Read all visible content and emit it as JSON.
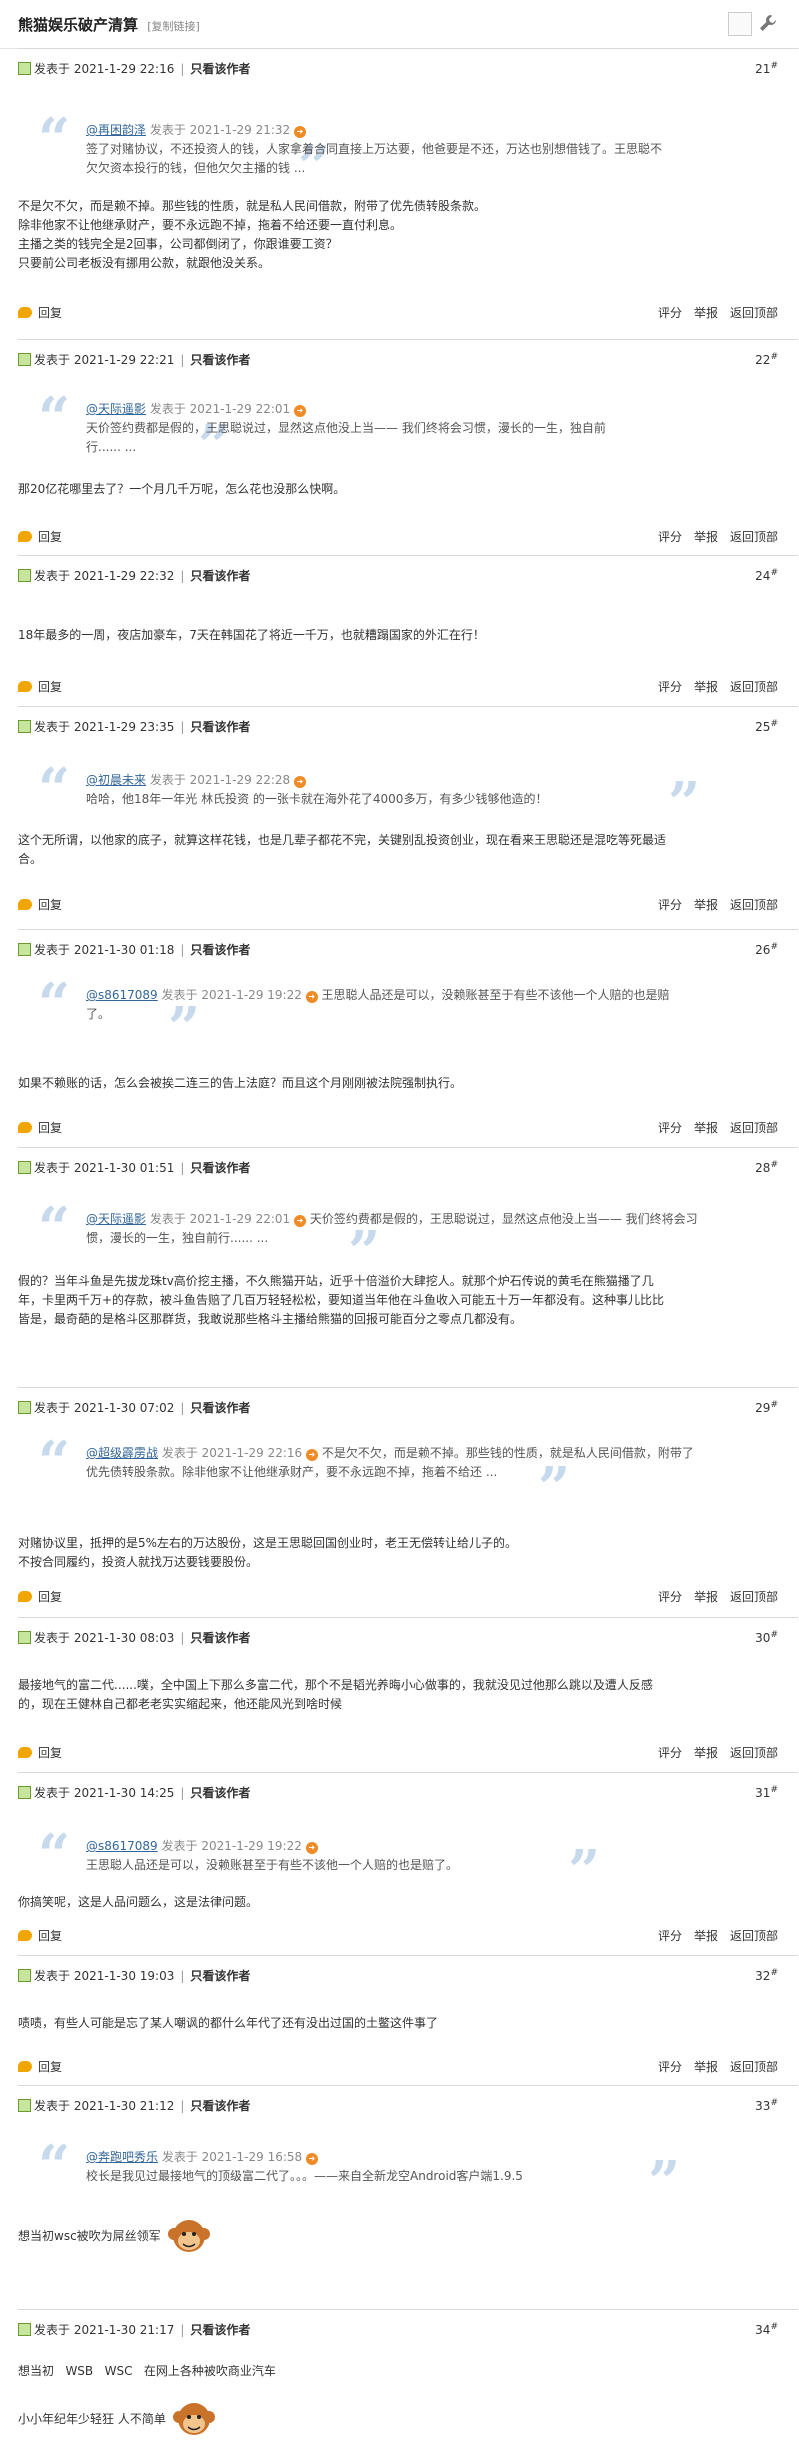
{
  "header": {
    "title": "熊猫娱乐破产清算",
    "copy_link": "[复制链接]"
  },
  "common": {
    "posted": "发表于",
    "only_author": "只看该作者",
    "reply": "回复",
    "rate": "评分",
    "report": "举报",
    "top": "返回顶部",
    "floor_sign": "#"
  },
  "posts": [
    {
      "date": "2021-1-29 22:16",
      "floor": "21",
      "quote": {
        "user": "@再困韵泽",
        "time": "发表于 2021-1-29 21:32",
        "text1": "签了对赌协议，不还投资人的钱，人家拿着合同直接上万达要，他爸要是不还，万达也别想借钱了。王思聪不",
        "text2": "欠欠资本投行的钱，但他欠欠主播的钱 ..."
      },
      "body": [
        "不是欠不欠，而是赖不掉。那些钱的性质，就是私人民间借款，附带了优先债转股条款。",
        "除非他家不让他继承财产，要不永远跑不掉，拖着不给还要一直付利息。",
        "主播之类的钱完全是2回事，公司都倒闭了，你跟谁要工资？",
        "只要前公司老板没有挪用公款，就跟他没关系。"
      ]
    },
    {
      "date": "2021-1-29 22:21",
      "floor": "22",
      "quote": {
        "user": "@天际遥影",
        "time": "发表于 2021-1-29 22:01",
        "text1": "天价签约费都是假的，王思聪说过，显然这点他没上当—— 我们终将会习惯，漫长的一生，独自前",
        "text2": "行...... ..."
      },
      "body": [
        "那20亿花哪里去了？一个月几千万呢，怎么花也没那么快啊。"
      ]
    },
    {
      "date": "2021-1-29 22:32",
      "floor": "24",
      "body": [
        "18年最多的一周，夜店加豪车，7天在韩国花了将近一千万，也就糟蹋国家的外汇在行！"
      ]
    },
    {
      "date": "2021-1-29 23:35",
      "floor": "25",
      "quote": {
        "user": "@初晨未来",
        "time": "发表于 2021-1-29 22:28",
        "text1": "哈哈，他18年一年光 林氏投资 的一张卡就在海外花了4000多万，有多少钱够他造的！",
        "text2": ""
      },
      "body": [
        "这个无所谓，以他家的底子，就算这样花钱，也是几辈子都花不完，关键别乱投资创业，现在看来王思聪还是混吃等死最适",
        "合。"
      ]
    },
    {
      "date": "2021-1-30 01:18",
      "floor": "26",
      "quote": {
        "user": "@s8617089",
        "time": "发表于 2021-1-29 19:22",
        "text1": "王思聪人品还是可以，没赖账甚至于有些不该他一个人赔的也是赔",
        "text2": "了。"
      },
      "body": [
        "如果不赖账的话，怎么会被挨二连三的告上法庭？而且这个月刚刚被法院强制执行。"
      ]
    },
    {
      "date": "2021-1-30 01:51",
      "floor": "28",
      "quote": {
        "user": "@天际遥影",
        "time": "发表于 2021-1-29 22:01",
        "text1": "天价签约费都是假的，王思聪说过，显然这点他没上当—— 我们终将会习",
        "text2": "惯，漫长的一生，独自前行...... ..."
      },
      "body": [
        "假的？当年斗鱼是先拔龙珠tv高价挖主播，不久熊猫开站，近乎十倍溢价大肆挖人。就那个炉石传说的黄毛在熊猫播了几",
        "年，卡里两千万+的存款，被斗鱼告赔了几百万轻轻松松，要知道当年他在斗鱼收入可能五十万一年都没有。这种事儿比比",
        "皆是，最奇葩的是格斗区那群货，我敢说那些格斗主播给熊猫的回报可能百分之零点几都没有。"
      ]
    },
    {
      "date": "2021-1-30 07:02",
      "floor": "29",
      "quote": {
        "user": "@超级霹雳战",
        "time": "发表于 2021-1-29 22:16",
        "text1": "不是欠不欠，而是赖不掉。那些钱的性质，就是私人民间借款，附带了",
        "text2": "优先债转股条款。除非他家不让他继承财产，要不永远跑不掉，拖着不给还 ..."
      },
      "body": [
        "对赌协议里，抵押的是5%左右的万达股份，这是王思聪回国创业时，老王无偿转让给儿子的。",
        "不按合同履约，投资人就找万达要钱要股份。"
      ]
    },
    {
      "date": "2021-1-30 08:03",
      "floor": "30",
      "body": [
        "最接地气的富二代......噗，全中国上下那么多富二代，那个不是韬光养晦小心做事的，我就没见过他那么跳以及遭人反感",
        "的，现在王健林自己都老老实实缩起来，他还能风光到啥时候"
      ]
    },
    {
      "date": "2021-1-30 14:25",
      "floor": "31",
      "quote": {
        "user": "@s8617089",
        "time": "发表于 2021-1-29 19:22",
        "text1": "王思聪人品还是可以，没赖账甚至于有些不该他一个人赔的也是赔了。",
        "text2": ""
      },
      "body": [
        "你搞笑呢，这是人品问题么，这是法律问题。"
      ]
    },
    {
      "date": "2021-1-30 19:03",
      "floor": "32",
      "body": [
        "啧啧，有些人可能是忘了某人嘲讽的都什么年代了还有没出过国的土鳖这件事了"
      ]
    },
    {
      "date": "2021-1-30 21:12",
      "floor": "33",
      "quote": {
        "user": "@奔跑吧秀乐",
        "time": "发表于 2021-1-29 16:58",
        "text1": "校长是我见过最接地气的顶级富二代了。。。——来自全新龙空Android客户端1.9.5",
        "text2": ""
      },
      "body": [
        "想当初wsc被吹为屌丝领军"
      ]
    },
    {
      "date": "2021-1-30 21:17",
      "floor": "34",
      "body": [
        "想当初   WSB   WSC   在网上各种被吹商业汽车",
        "小小年纪年少轻狂 人不简单"
      ]
    }
  ]
}
